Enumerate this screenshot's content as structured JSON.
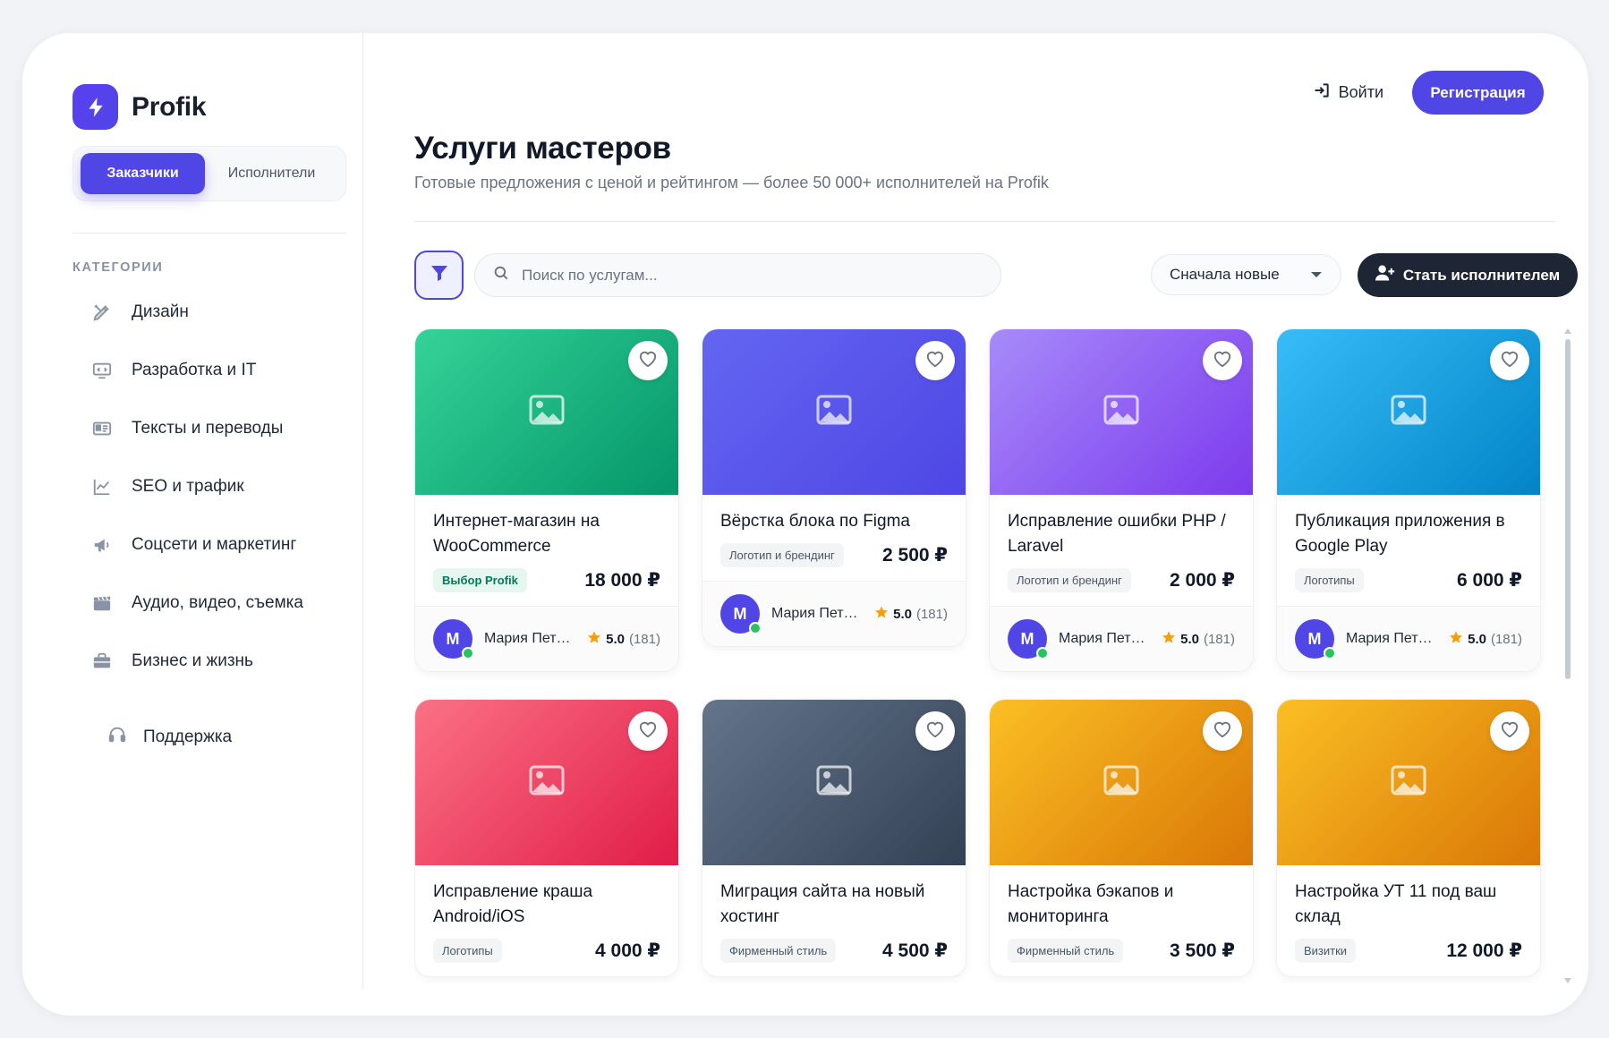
{
  "app": {
    "name": "Profik",
    "logo_icon": "lightning-icon"
  },
  "roles": {
    "active": "Заказчики",
    "inactive": "Исполнители"
  },
  "categories": {
    "title": "КАТЕГОРИИ",
    "items": [
      {
        "label": "Дизайн",
        "icon": "design-tools-icon"
      },
      {
        "label": "Разработка и IT",
        "icon": "code-monitor-icon"
      },
      {
        "label": "Тексты и переводы",
        "icon": "text-card-icon"
      },
      {
        "label": "SEO и трафик",
        "icon": "chart-line-icon"
      },
      {
        "label": "Соцсети и маркетинг",
        "icon": "megaphone-icon"
      },
      {
        "label": "Аудио, видео, съемка",
        "icon": "clapperboard-icon"
      },
      {
        "label": "Бизнес и жизнь",
        "icon": "briefcase-icon"
      }
    ]
  },
  "support": {
    "label": "Поддержка",
    "icon": "headset-icon"
  },
  "topbar": {
    "login": "Войти",
    "login_icon": "sign-in-icon",
    "register": "Регистрация"
  },
  "header": {
    "title": "Услуги мастеров",
    "subtitle": "Готовые предложения с ценой и рейтингом — более 50 000+ исполнителей на Profik"
  },
  "toolbar": {
    "filter_icon": "filter-icon",
    "search_placeholder": "Поиск по услугам...",
    "sort_selected": "Сначала новые",
    "become": "Стать исполнителем",
    "become_icon": "user-plus-icon"
  },
  "colors": {
    "accent": "#4f46e5",
    "dark": "#1e2636",
    "star": "#f59e0b",
    "online": "#22c55e"
  },
  "cards": [
    {
      "title": "Интернет-магазин на WooCommerce",
      "tag": "Выбор Profik",
      "tag_style": "choice",
      "price": "18 000 ₽",
      "gradient": [
        "#34d399",
        "#059669"
      ],
      "author_initial": "M",
      "author": "Мария Петрова",
      "rating": "5.0",
      "reviews": "(181)",
      "online": true
    },
    {
      "title": "Вёрстка блока по Figma",
      "tag": "Логотип и брендинг",
      "tag_style": "",
      "price": "2 500 ₽",
      "gradient": [
        "#6366f1",
        "#4f46e5"
      ],
      "author_initial": "M",
      "author": "Мария Петрова",
      "rating": "5.0",
      "reviews": "(181)",
      "online": true
    },
    {
      "title": "Исправление ошибки PHP / Laravel",
      "tag": "Логотип и брендинг",
      "tag_style": "",
      "price": "2 000 ₽",
      "gradient": [
        "#a78bfa",
        "#7c3aed"
      ],
      "author_initial": "M",
      "author": "Мария Петрова",
      "rating": "5.0",
      "reviews": "(181)",
      "online": true
    },
    {
      "title": "Публикация приложения в Google Play",
      "tag": "Логотипы",
      "tag_style": "",
      "price": "6 000 ₽",
      "gradient": [
        "#38bdf8",
        "#0284c7"
      ],
      "author_initial": "M",
      "author": "Мария Петрова",
      "rating": "5.0",
      "reviews": "(181)",
      "online": true
    },
    {
      "title": "Исправление краша Android/iOS",
      "tag": "Логотипы",
      "tag_style": "",
      "price": "4 000 ₽",
      "gradient": [
        "#fb7185",
        "#e11d48"
      ],
      "author_initial": "",
      "author": "",
      "rating": "",
      "reviews": "",
      "online": false
    },
    {
      "title": "Миграция сайта на новый хостинг",
      "tag": "Фирменный стиль",
      "tag_style": "",
      "price": "4 500 ₽",
      "gradient": [
        "#64748b",
        "#334155"
      ],
      "author_initial": "",
      "author": "",
      "rating": "",
      "reviews": "",
      "online": false
    },
    {
      "title": "Настройка бэкапов и мониторинга",
      "tag": "Фирменный стиль",
      "tag_style": "",
      "price": "3 500 ₽",
      "gradient": [
        "#fbbf24",
        "#d97706"
      ],
      "author_initial": "",
      "author": "",
      "rating": "",
      "reviews": "",
      "online": false
    },
    {
      "title": "Настройка УТ 11 под ваш склад",
      "tag": "Визитки",
      "tag_style": "",
      "price": "12 000 ₽",
      "gradient": [
        "#fbbf24",
        "#d97706"
      ],
      "author_initial": "",
      "author": "",
      "rating": "",
      "reviews": "",
      "online": false
    }
  ]
}
